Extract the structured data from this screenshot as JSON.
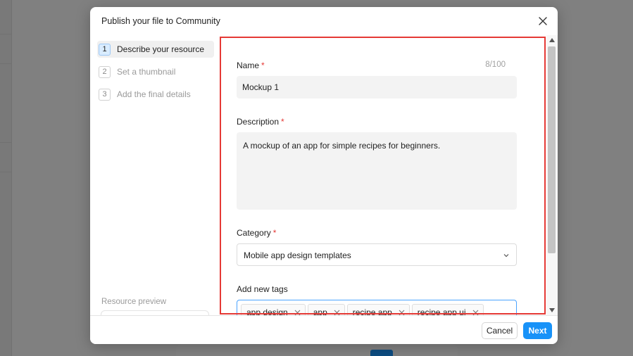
{
  "modal": {
    "title": "Publish your file to Community"
  },
  "steps": [
    {
      "number": "1",
      "label": "Describe your resource",
      "active": true
    },
    {
      "number": "2",
      "label": "Set a thumbnail",
      "active": false
    },
    {
      "number": "3",
      "label": "Add the final details",
      "active": false
    }
  ],
  "preview": {
    "label": "Resource preview",
    "icon": "globe-icon"
  },
  "form": {
    "name": {
      "label": "Name",
      "required_mark": "*",
      "value": "Mockup 1",
      "counter": "8/100"
    },
    "description": {
      "label": "Description",
      "required_mark": "*",
      "value": "A mockup of an app for simple recipes for beginners."
    },
    "category": {
      "label": "Category",
      "required_mark": "*",
      "value": "Mobile app design templates"
    },
    "tags": {
      "label": "Add new tags",
      "items": [
        "app design",
        "app",
        "recipe app",
        "recipe app ui"
      ]
    }
  },
  "footer": {
    "cancel_label": "Cancel",
    "next_label": "Next"
  },
  "colors": {
    "accent": "#1892f8",
    "highlight": "#e53935",
    "required": "#e53935"
  }
}
